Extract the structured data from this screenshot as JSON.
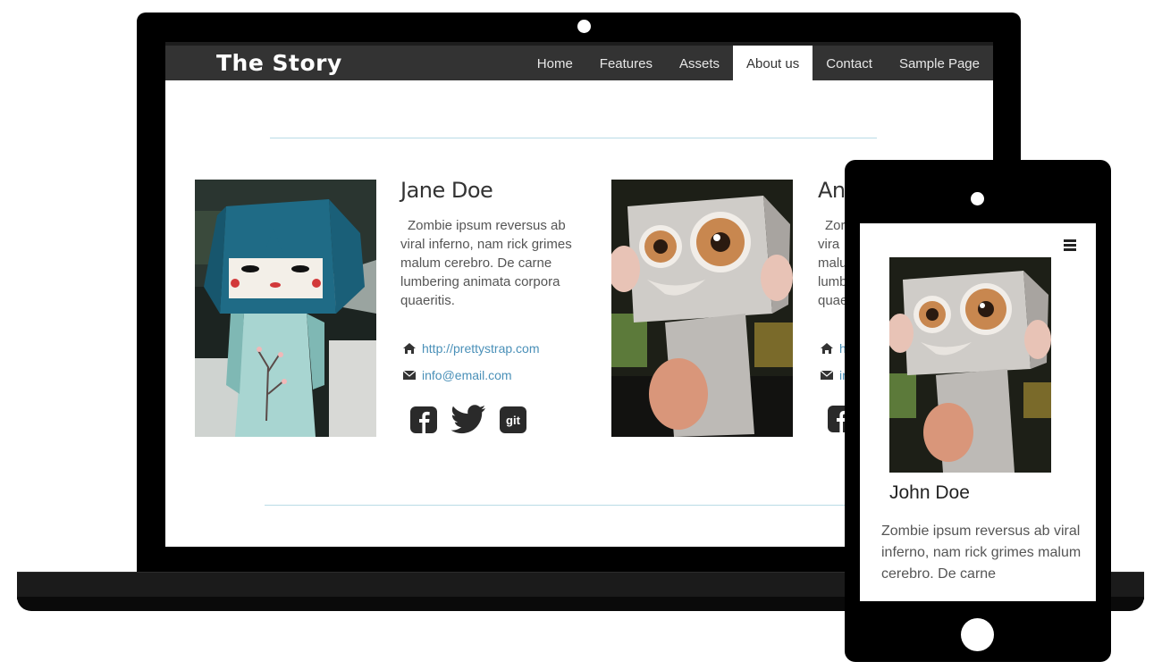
{
  "site": {
    "brand": "The Story",
    "nav": [
      "Home",
      "Features",
      "Assets",
      "About us",
      "Contact",
      "Sample Page"
    ],
    "active_nav": "About us"
  },
  "team": [
    {
      "name": "Jane Doe",
      "bio": "Zombie ipsum reversus ab viral inferno, nam rick grimes malum cerebro. De carne lumbering animata corpora quaeritis.",
      "website": "http://prettystrap.com",
      "email": "info@email.com",
      "social": [
        "facebook-icon",
        "twitter-icon",
        "git-icon"
      ],
      "social_label_git": "git"
    },
    {
      "name": "And",
      "bio": [
        "Zor",
        "vira",
        "malu",
        "lumb",
        "quae"
      ],
      "website": "h",
      "email": "ir"
    }
  ],
  "mobile": {
    "name": "John Doe",
    "bio": "Zombie ipsum reversus ab viral inferno, nam rick grimes malum cerebro. De carne"
  },
  "colors": {
    "navbar": "#333333",
    "link": "#4a90b8",
    "rule": "#b9dbe6",
    "device": "#000000"
  }
}
